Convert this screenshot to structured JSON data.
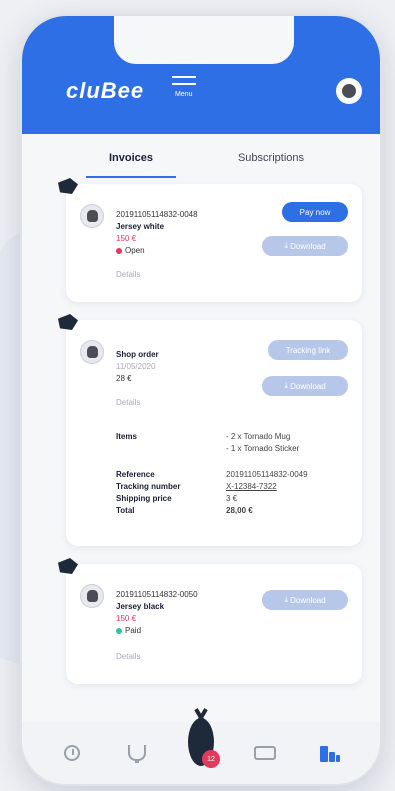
{
  "app": {
    "logo": "cluBee",
    "menu_label": "Menu"
  },
  "colors": {
    "brand": "#2f6fe6",
    "open": "#e23a5f",
    "paid": "#2ec4a0"
  },
  "tabs": [
    {
      "label": "Invoices",
      "active": true
    },
    {
      "label": "Subscriptions",
      "active": false
    }
  ],
  "invoices": [
    {
      "number": "20191105114832-0048",
      "item": "Jersey white",
      "amount": "150 €",
      "status": "Open",
      "status_color": "#e23a5f",
      "details": "Details",
      "pay_label": "Pay now",
      "download_label": "Download"
    },
    {
      "title": "Shop order",
      "date": "11/05/2020",
      "amount": "28 €",
      "details": "Details",
      "tracking_label": "Tracking link",
      "download_label": "Download",
      "items_label": "Items",
      "items": [
        "- 2 x Tornado Mug",
        "- 1 x Tornado Sticker"
      ],
      "reference_label": "Reference",
      "reference": "20191105114832-0049",
      "tracking_number_label": "Tracking number",
      "tracking_number": "X-12384-7322",
      "shipping_label": "Shipping price",
      "shipping": "3 €",
      "total_label": "Total",
      "total": "28,00 €"
    },
    {
      "number": "20191105114832-0050",
      "item": "Jersey black",
      "amount": "150 €",
      "status": "Paid",
      "status_color": "#2ec4a0",
      "details": "Details",
      "download_label": "Download"
    }
  ],
  "nav": {
    "mascot_badge": "12"
  }
}
